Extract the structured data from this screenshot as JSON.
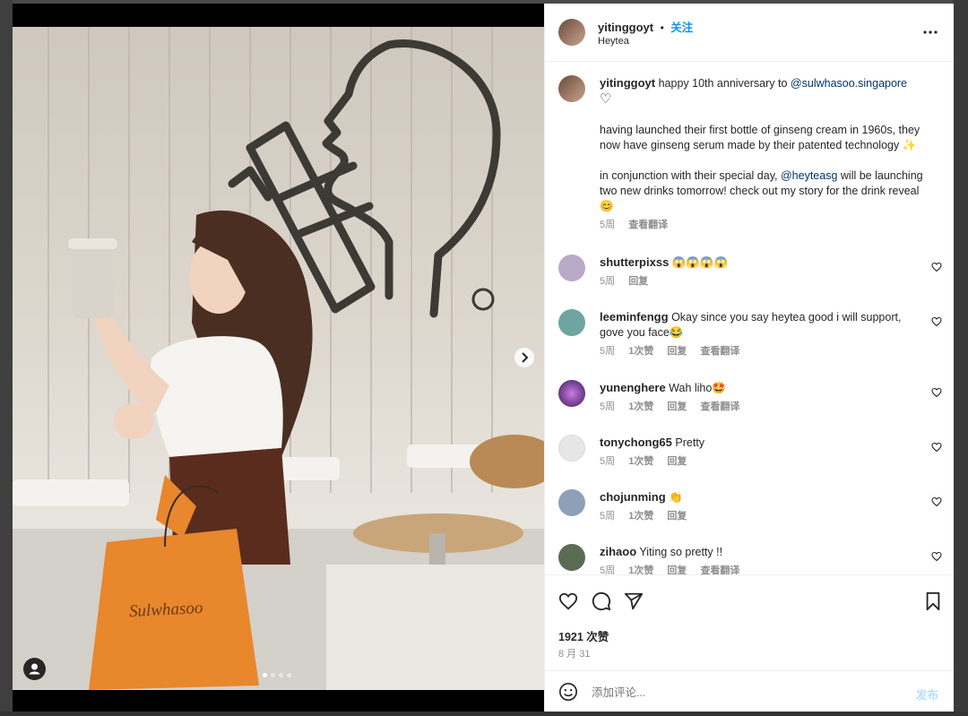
{
  "post": {
    "username": "yitinggoyt",
    "follow_label": "关注",
    "location": "Heytea",
    "more_label": "•••"
  },
  "photo": {
    "bag_brand": "Sulwhasoo",
    "carousel_total": 4,
    "carousel_index": 1
  },
  "caption": {
    "username": "yitinggoyt",
    "text_before": "happy 10th anniversary to",
    "mention": "@sulwhasoo.singapore",
    "heart": "♡",
    "para1": "having launched their first bottle of ginseng cream in 1960s, they now have ginseng serum made by their patented technology ✨",
    "para2_before": "in conjunction with their special day,",
    "para2_mention": "@heyteasg",
    "para2_after": "will be launching two new drinks tomorrow! check out my story for the drink reveal 😊",
    "time": "5周",
    "translate": "查看翻译"
  },
  "comments": [
    {
      "username": "shutterpixss",
      "text": "😱😱😱😱",
      "time": "5周",
      "likes": "",
      "reply": "回复",
      "translate": "",
      "avatar_color": "#b8a9c9"
    },
    {
      "username": "leeminfengg",
      "text": "Okay since you say heytea good i will support, gove you face😂",
      "time": "5周",
      "likes": "1次赞",
      "reply": "回复",
      "translate": "查看翻译",
      "avatar_color": "#6fa5a0"
    },
    {
      "username": "yunenghere",
      "text": "Wah liho🤩",
      "time": "5周",
      "likes": "1次赞",
      "reply": "回复",
      "translate": "查看翻译",
      "avatar_color": "#7a3fa8"
    },
    {
      "username": "tonychong65",
      "text": "Pretty",
      "time": "5周",
      "likes": "1次赞",
      "reply": "回复",
      "translate": "",
      "avatar_color": "#dbdbdb"
    },
    {
      "username": "chojunming",
      "text": "👏",
      "time": "5周",
      "likes": "1次赞",
      "reply": "回复",
      "translate": "",
      "avatar_color": "#8da0b8"
    },
    {
      "username": "zihaoo",
      "text": "Yiting so pretty !!",
      "time": "5周",
      "likes": "1次赞",
      "reply": "回复",
      "translate": "查看翻译",
      "avatar_color": "#5b6b54"
    }
  ],
  "stats": {
    "likes": "1921 次赞",
    "date": "8 月 31"
  },
  "add_comment": {
    "placeholder": "添加评论...",
    "post_label": "发布"
  },
  "icons": {
    "heart": "heart-icon",
    "comment": "comment-icon",
    "share": "share-icon",
    "save": "bookmark-icon",
    "emoji": "emoji-icon",
    "more": "more-icon",
    "next": "chevron-right-icon",
    "tag": "user-tag-icon"
  },
  "colors": {
    "link": "#00376b",
    "follow": "#0095f6",
    "muted": "#8e8e8e",
    "post_disabled": "#b2dffc"
  }
}
